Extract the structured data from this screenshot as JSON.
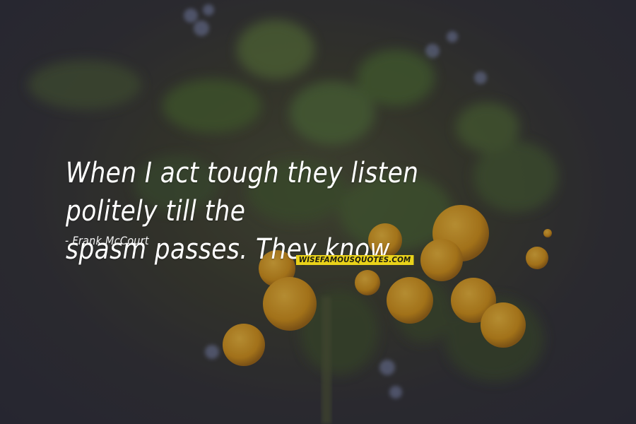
{
  "quote": {
    "lines": [
      "When I act tough they listen politely till the",
      "spasm passes. They know."
    ]
  },
  "author": "- Frank McCourt",
  "watermark": "WISEFAMOUSQUOTES.COM",
  "colors": {
    "text": "#ffffff",
    "watermark_bg": "#e9d21a",
    "fruit": "#f0a91c",
    "background": "#302f35"
  }
}
